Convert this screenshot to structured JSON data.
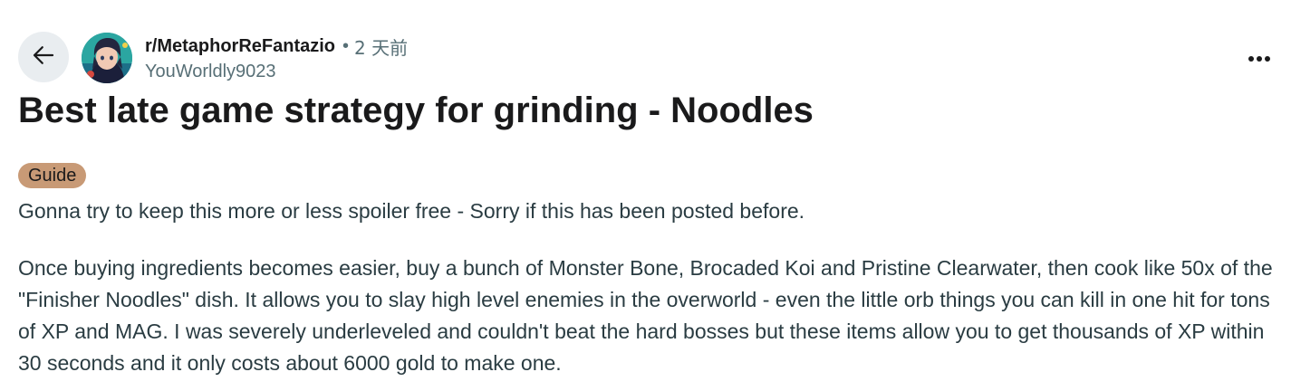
{
  "header": {
    "back_icon": "arrow-left-icon",
    "subreddit": "r/MetaphorReFantazio",
    "separator": "•",
    "time_ago": "2 天前",
    "author": "YouWorldly9023",
    "overflow_icon": "more-horizontal-icon"
  },
  "post": {
    "title": "Best late game strategy for grinding - Noodles",
    "flair": "Guide",
    "flair_color": "#c89a76",
    "paragraphs": [
      "Gonna try to keep this more or less spoiler free - Sorry if this has been posted before.",
      "Once buying ingredients becomes easier, buy a bunch of Monster Bone, Brocaded Koi and Pristine Clearwater, then cook like 50x of the \"Finisher Noodles\" dish. It allows you to slay high level enemies in the overworld - even the little orb things you can kill in one hit for tons of XP and MAG. I was severely underleveled and couldn't beat the hard bosses but these items allow you to get thousands of XP within 30 seconds and it only costs about 6000 gold to make one."
    ]
  }
}
